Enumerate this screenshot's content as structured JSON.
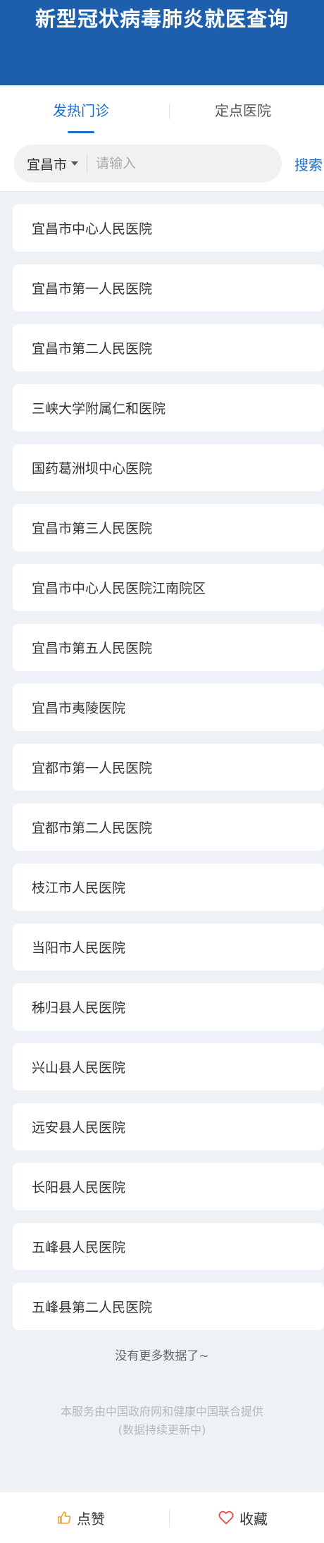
{
  "header": {
    "title": "新型冠状病毒肺炎就医查询"
  },
  "tabs": [
    {
      "label": "发热门诊",
      "active": true
    },
    {
      "label": "定点医院",
      "active": false
    }
  ],
  "search": {
    "city": "宜昌市",
    "placeholder": "请输入",
    "button_label": "搜索"
  },
  "hospitals": [
    "宜昌市中心人民医院",
    "宜昌市第一人民医院",
    "宜昌市第二人民医院",
    "三峡大学附属仁和医院",
    "国药葛洲坝中心医院",
    "宜昌市第三人民医院",
    "宜昌市中心人民医院江南院区",
    "宜昌市第五人民医院",
    "宜昌市夷陵医院",
    "宜都市第一人民医院",
    "宜都市第二人民医院",
    "枝江市人民医院",
    "当阳市人民医院",
    "秭归县人民医院",
    "兴山县人民医院",
    "远安县人民医院",
    "长阳县人民医院",
    "五峰县人民医院",
    "五峰县第二人民医院"
  ],
  "list_footer": {
    "no_more": "没有更多数据了~",
    "source_line1": "本服务由中国政府网和健康中国联合提供",
    "source_line2": "(数据持续更新中)"
  },
  "bottom_bar": {
    "like_label": "点赞",
    "like_icon": "thumbs-up-icon",
    "favorite_label": "收藏",
    "favorite_icon": "heart-icon"
  },
  "colors": {
    "header_bg": "#1e5fad",
    "accent": "#1e6ec8",
    "like_icon": "#f0a030",
    "heart_icon": "#e8443a"
  }
}
